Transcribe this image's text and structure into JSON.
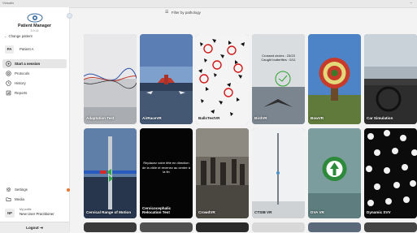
{
  "window": {
    "title": "Virtualis"
  },
  "sidebar": {
    "app_name": "Patient Manager",
    "app_version": "3.9.14",
    "change_patient": "Change patient",
    "patient": {
      "initials": "PA",
      "name": "Patient A"
    },
    "nav": [
      {
        "label": "Start a session",
        "icon": "play-icon"
      },
      {
        "label": "Protocols",
        "icon": "protocols-icon"
      },
      {
        "label": "History",
        "icon": "history-icon"
      },
      {
        "label": "Reports",
        "icon": "reports-icon"
      }
    ],
    "bottom_nav": [
      {
        "label": "Settings",
        "icon": "gear-icon"
      },
      {
        "label": "Media",
        "icon": "folder-icon"
      }
    ],
    "user": {
      "initials": "NP",
      "label": "My profile",
      "name": "New User Practitioner"
    },
    "logout": "Logout"
  },
  "filter": {
    "label": "Filter by pathology"
  },
  "cards": [
    {
      "name": "Adaptation Test"
    },
    {
      "name": "AirRaceVR"
    },
    {
      "name": "BallsTestVR"
    },
    {
      "name": "BirdVR",
      "overlay1": "Crossed circles : 23/23",
      "overlay2": "Caught butterflies : 0/11"
    },
    {
      "name": "BowVR"
    },
    {
      "name": "Car Simulation"
    },
    {
      "name": "Cervical Range of Motion"
    },
    {
      "name": "Cervicocephalic Relocation Test",
      "overlay1": "Replacez votre tête en direction",
      "overlay2": "de la cible et revenez au centre à la fin"
    },
    {
      "name": "CrowdVR"
    },
    {
      "name": "CTSIB VR"
    },
    {
      "name": "DVA VR"
    },
    {
      "name": "Dynamic SVV"
    }
  ],
  "colors": {
    "accent_dot": "#e8742c",
    "active_nav": "#e6e6e6"
  }
}
